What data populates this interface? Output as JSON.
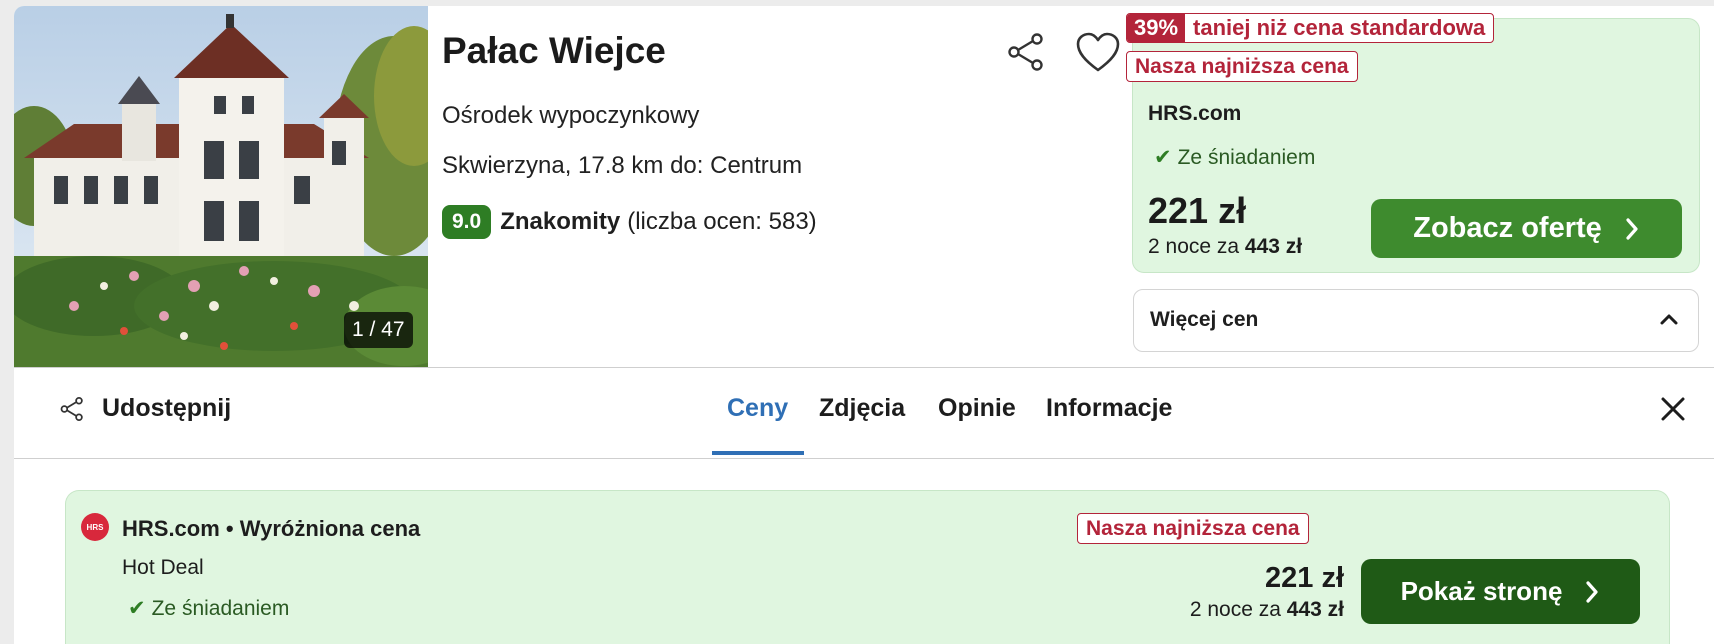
{
  "hotel": {
    "name": "Pałac Wiejce",
    "type": "Ośrodek wypoczynkowy",
    "location": "Skwierzyna, 17.8 km do: Centrum",
    "rating_score": "9.0",
    "rating_word": "Znakomity",
    "rating_count": "(liczba ocen: 583)",
    "photo_counter": "1 / 47"
  },
  "deal": {
    "discount_pct": "39%",
    "discount_text": "taniej niż cena standardowa",
    "lowest_badge": "Nasza najniższa cena",
    "provider": "HRS.com",
    "breakfast": "Ze śniadaniem",
    "price": "221 zł",
    "total_prefix": "2 noce za",
    "total_amount": "443 zł",
    "button_label": "Zobacz ofertę",
    "more_prices_label": "Więcej cen"
  },
  "tabs": {
    "share_label": "Udostępnij",
    "items": [
      "Ceny",
      "Zdjęcia",
      "Opinie",
      "Informacje"
    ],
    "active": "Ceny"
  },
  "offer": {
    "logo_text": "HRS",
    "title": "HRS.com • Wyróżniona cena",
    "deal_name": "Hot Deal",
    "breakfast": "Ze śniadaniem",
    "lowest_badge": "Nasza najniższa cena",
    "price": "221 zł",
    "total_prefix": "2 noce za",
    "total_amount": "443 zł",
    "button_label": "Pokaż stronę"
  },
  "colors": {
    "accent_blue": "#2f6fb5",
    "green_button": "#3e8b2e",
    "dark_green_button": "#1f5a16",
    "deal_background": "#e0f6e0",
    "badge_red": "#b3243a"
  }
}
